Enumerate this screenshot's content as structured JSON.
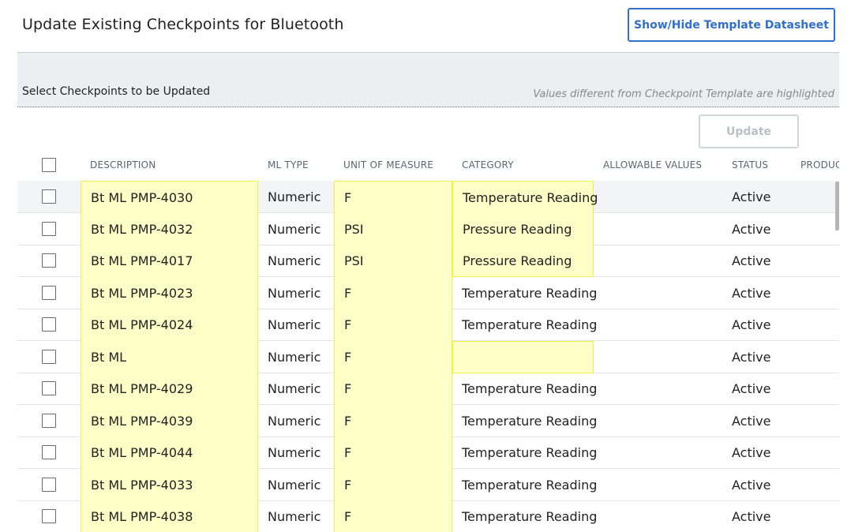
{
  "header": {
    "title": "Update Existing Checkpoints for Bluetooth",
    "toggle_label": "Show/Hide Template Datasheet"
  },
  "panel": {
    "label": "Select Checkpoints to be Updated",
    "note": "Values different from Checkpoint Template are highlighted"
  },
  "update_label": "Update",
  "columns": [
    "DESCRIPTION",
    "ML TYPE",
    "UNIT OF MEASURE",
    "CATEGORY",
    "ALLOWABLE VALUES",
    "STATUS",
    "PRODUC"
  ],
  "rows": [
    {
      "description": "Bt ML PMP-4030",
      "ml_type": "Numeric",
      "unit": "F",
      "category": "Temperature Reading",
      "allowable": "",
      "status": "Active"
    },
    {
      "description": "Bt ML PMP-4032",
      "ml_type": "Numeric",
      "unit": "PSI",
      "category": "Pressure Reading",
      "allowable": "",
      "status": "Active"
    },
    {
      "description": "Bt ML PMP-4017",
      "ml_type": "Numeric",
      "unit": "PSI",
      "category": "Pressure Reading",
      "allowable": "",
      "status": "Active"
    },
    {
      "description": "Bt ML PMP-4023",
      "ml_type": "Numeric",
      "unit": "F",
      "category": "Temperature Reading",
      "allowable": "",
      "status": "Active"
    },
    {
      "description": "Bt ML PMP-4024",
      "ml_type": "Numeric",
      "unit": "F",
      "category": "Temperature Reading",
      "allowable": "",
      "status": "Active"
    },
    {
      "description": "Bt ML",
      "ml_type": "Numeric",
      "unit": "F",
      "category": "",
      "allowable": "",
      "status": "Active"
    },
    {
      "description": "Bt ML PMP-4029",
      "ml_type": "Numeric",
      "unit": "F",
      "category": "Temperature Reading",
      "allowable": "",
      "status": "Active"
    },
    {
      "description": "Bt ML PMP-4039",
      "ml_type": "Numeric",
      "unit": "F",
      "category": "Temperature Reading",
      "allowable": "",
      "status": "Active"
    },
    {
      "description": "Bt ML PMP-4044",
      "ml_type": "Numeric",
      "unit": "F",
      "category": "Temperature Reading",
      "allowable": "",
      "status": "Active"
    },
    {
      "description": "Bt ML PMP-4033",
      "ml_type": "Numeric",
      "unit": "F",
      "category": "Temperature Reading",
      "allowable": "",
      "status": "Active"
    },
    {
      "description": "Bt ML PMP-4038",
      "ml_type": "Numeric",
      "unit": "F",
      "category": "Temperature Reading",
      "allowable": "",
      "status": "Active"
    }
  ],
  "highlighted_category_rows": [
    0,
    1,
    2,
    5
  ],
  "colors": {
    "highlight": "#ffffc8",
    "highlight_border": "#f0f04a",
    "accent": "#2f6fd0",
    "disabled": "#b9bfc5"
  }
}
